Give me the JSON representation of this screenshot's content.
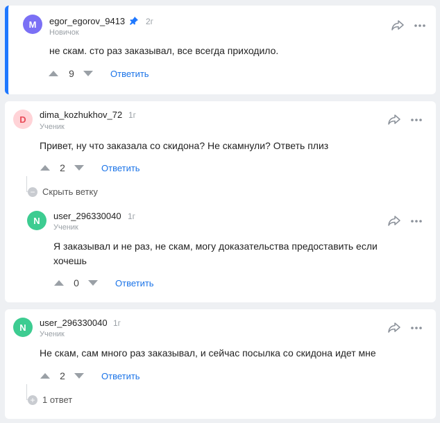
{
  "comments": [
    {
      "avatar_letter": "M",
      "avatar_color": "#7b70f5",
      "username": "egor_egorov_9413",
      "pin_icon": "pin-icon",
      "time": "2г",
      "role": "Новичок",
      "text": "не скам. сто раз заказывал, все всегда приходило.",
      "votes": "9",
      "reply_label": "Ответить"
    },
    {
      "avatar_letter": "D",
      "avatar_color": "#ffd3d7",
      "avatar_text_color": "#e84b58",
      "username": "dima_kozhukhov_72",
      "time": "1г",
      "role": "Ученик",
      "text": "Привет, ну что заказала со скидона? Не скамнули? Ответь плиз",
      "votes": "2",
      "reply_label": "Ответить",
      "thread_toggle": "Скрыть ветку"
    },
    {
      "avatar_letter": "N",
      "avatar_color": "#3dcc91",
      "username": "user_296330040",
      "time": "1г",
      "role": "Ученик",
      "text_line1": "Я заказывал и не раз, не скам, могу доказательства предоставить если",
      "text_line2": "хочешь",
      "votes": "0",
      "reply_label": "Ответить"
    },
    {
      "avatar_letter": "N",
      "avatar_color": "#3dcc91",
      "username": "user_296330040",
      "time": "1г",
      "role": "Ученик",
      "text": "Не скам, сам много раз заказывал, и сейчас посылка со скидона идет мне",
      "votes": "2",
      "reply_label": "Ответить",
      "replies_label": "1 ответ"
    }
  ],
  "icons": {
    "share": "share-icon",
    "more": "more-icon",
    "upvote": "upvote-icon",
    "downvote": "downvote-icon"
  }
}
